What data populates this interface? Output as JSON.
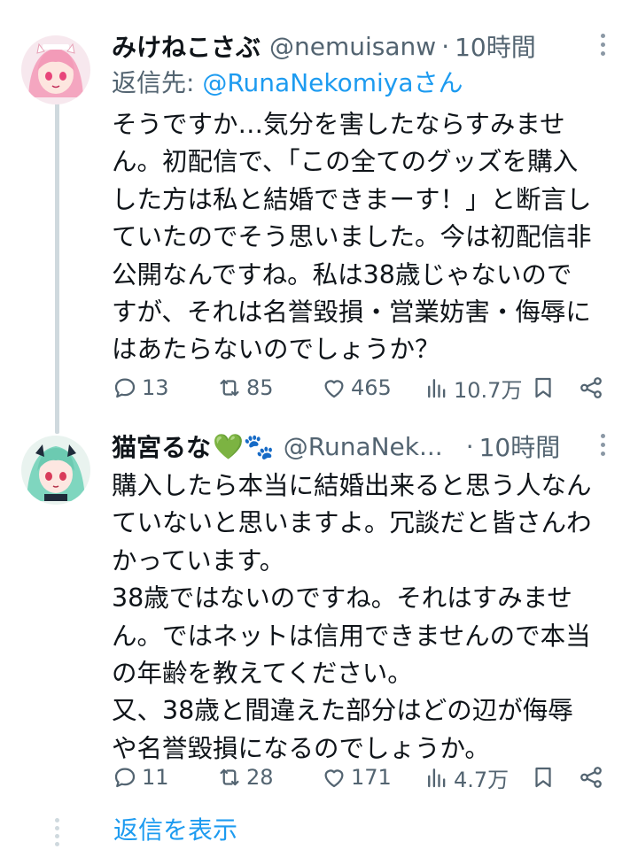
{
  "tweets": [
    {
      "name": "みけねこさぶ",
      "handle": "@nemuisanw",
      "separator": "·",
      "time": "10時間",
      "reply_prefix": "返信先:",
      "reply_handle": "@RunaNekomiya",
      "reply_suffix": "さん",
      "lines": [
        "そうですか…気分を害したならすみませ",
        "ん。初配信で、「この全てのグッズを購入",
        "した方は私と結婚できまーす！」と断言し",
        "ていたのでそう思いました。今は初配信非",
        "公開なんですね。私は38歳じゃないので",
        "すが、それは名誉毀損・営業妨害・侮辱に",
        "はあたらないのでしょうか？"
      ],
      "replies": "13",
      "retweets": "85",
      "likes": "465",
      "views": "10.7万"
    },
    {
      "name": "猫宮るな",
      "name_emoji": "💚🐾",
      "handle": "@RunaNek...",
      "separator": "·",
      "time": "10時間",
      "lines": [
        "購入したら本当に結婚出来ると思う人なん",
        "ていないと思いますよ。冗談だと皆さんわ",
        "かっています。",
        "38歳ではないのですね。それはすみませ",
        "ん。ではネットは信用できませんので本当",
        "の年齢を教えてください。",
        "又、38歳と間違えた部分はどの辺が侮辱",
        "や名誉毀損になるのでしょうか。"
      ],
      "replies": "11",
      "retweets": "28",
      "likes": "171",
      "views": "4.7万"
    }
  ],
  "show_replies": "返信を表示",
  "colors": {
    "link": "#1d9bf0",
    "secondary": "#536471",
    "text": "#0f1419",
    "thread": "#cfd9de"
  }
}
